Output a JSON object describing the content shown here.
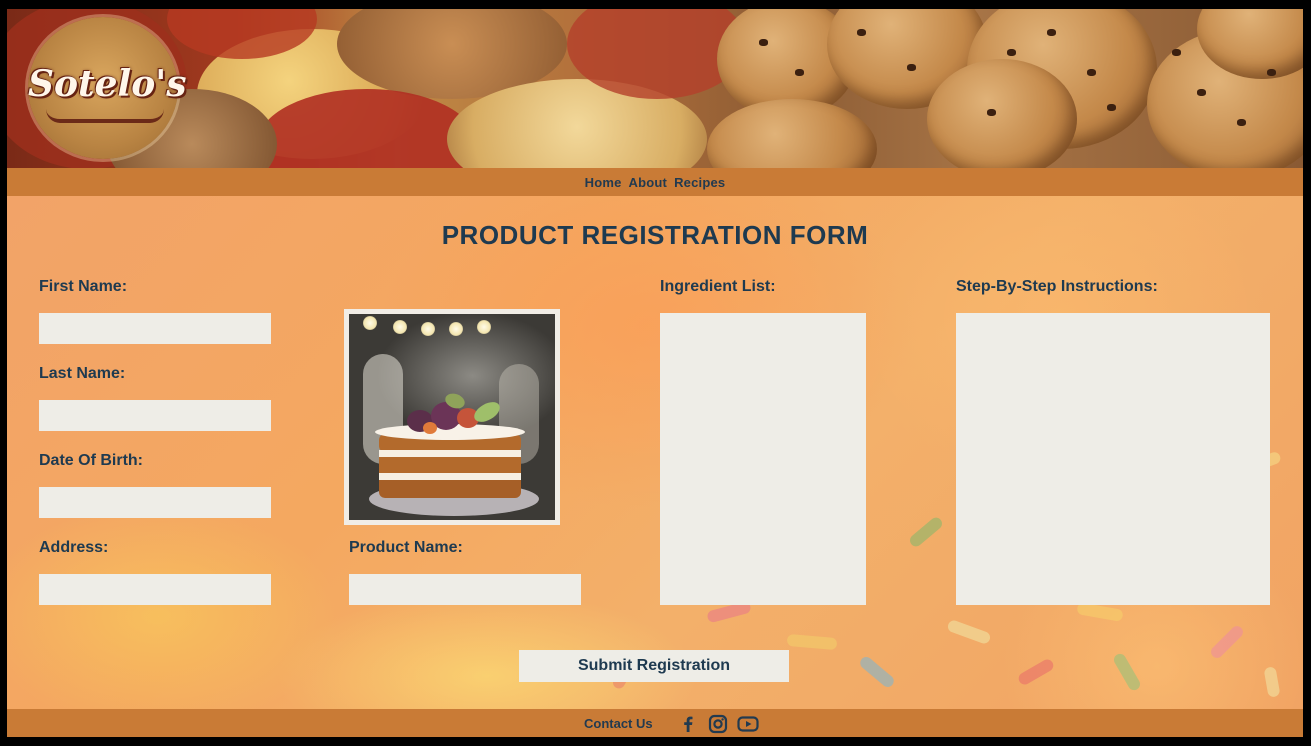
{
  "brand": {
    "logo_text": "Sotelo's"
  },
  "nav": {
    "items": [
      {
        "label": "Home"
      },
      {
        "label": "About"
      },
      {
        "label": "Recipes"
      }
    ]
  },
  "form": {
    "title": "PRODUCT REGISTRATION FORM",
    "fields": {
      "first_name": {
        "label": "First Name:",
        "value": ""
      },
      "last_name": {
        "label": "Last Name:",
        "value": ""
      },
      "date_of_birth": {
        "label": "Date Of Birth:",
        "value": ""
      },
      "address": {
        "label": "Address:",
        "value": ""
      },
      "product_name": {
        "label": "Product Name:",
        "value": ""
      },
      "ingredient_list": {
        "label": "Ingredient List:",
        "value": ""
      },
      "instructions": {
        "label": "Step-By-Step Instructions:",
        "value": ""
      }
    },
    "submit_label": "Submit Registration"
  },
  "footer": {
    "contact_label": "Contact Us",
    "social_icons": [
      "facebook-icon",
      "instagram-icon",
      "youtube-icon"
    ]
  },
  "colors": {
    "bar": "#c97b36",
    "text": "#1e3a50",
    "field": "#eeede7"
  }
}
